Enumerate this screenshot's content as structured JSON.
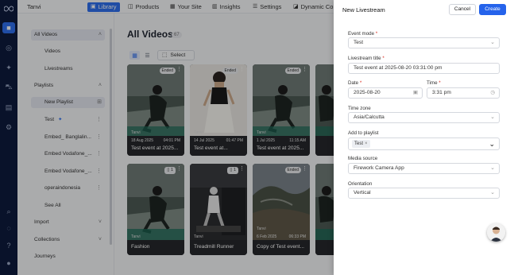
{
  "topbar": {
    "workspace": "Tanvi",
    "tabs": [
      {
        "label": "Library",
        "icon": "library-icon"
      },
      {
        "label": "Products",
        "icon": "bag-icon"
      },
      {
        "label": "Your Site",
        "icon": "globe-icon"
      },
      {
        "label": "Insights",
        "icon": "chart-icon"
      },
      {
        "label": "Settings",
        "icon": "settings-icon"
      },
      {
        "label": "Dynamic Co",
        "icon": "dynamic-icon"
      }
    ]
  },
  "sidebar": {
    "all_videos": "All Videos",
    "videos": "Videos",
    "livestreams": "Livestreams",
    "playlists": "Playlists",
    "new_playlist": "New Playlist",
    "playlist_items": [
      "Test",
      "Embed_ Banglalin...",
      "Embed Vodafone_...",
      "Embed Vodafone_...",
      "operaindonesia"
    ],
    "see_all": "See All",
    "import": "Import",
    "collections": "Collections",
    "journeys": "Journeys"
  },
  "main": {
    "title": "All Videos",
    "count": "67",
    "select_label": "Select",
    "cards": [
      {
        "title": "Test event at 2025...",
        "author": "Tanvi",
        "date": "18 Aug 2025",
        "time": "04:01 PM",
        "badge": "Ended"
      },
      {
        "title": "Test event at...",
        "author": "Tanvi",
        "date": "14 Jul 2025",
        "time": "01:47 PM",
        "badge": "Ended"
      },
      {
        "title": "Test event at 2025...",
        "author": "Tanvi",
        "date": "1 Jul 2025",
        "time": "11:15 AM",
        "badge": "Ended"
      },
      {
        "title": "",
        "author": "",
        "date": "",
        "time": "",
        "badge": ""
      },
      {
        "title": "Fashion",
        "author": "Tanvi",
        "date": "",
        "time": "",
        "badge": "1"
      },
      {
        "title": "Treadmill Runner",
        "author": "Tanvi",
        "date": "",
        "time": "",
        "badge": "1"
      },
      {
        "title": "Copy of Test event...",
        "author": "Tanvi",
        "date": "6 Feb 2025",
        "time": "06:33 PM",
        "badge": "Ended"
      },
      {
        "title": "",
        "author": "",
        "date": "",
        "time": "",
        "badge": ""
      }
    ]
  },
  "drawer": {
    "title": "New Livestream",
    "cancel": "Cancel",
    "create": "Create",
    "event_mode": {
      "label": "Event mode",
      "value": "Test"
    },
    "livestream_title": {
      "label": "Livestream title",
      "value": "Test event at 2025-08-20 03:31:00 pm"
    },
    "date": {
      "label": "Date",
      "value": "2025-08-20"
    },
    "time": {
      "label": "Time",
      "value": "3:31 pm"
    },
    "time_zone": {
      "label": "Time zone",
      "value": "Asia/Calcutta"
    },
    "add_to_playlist": {
      "label": "Add to playlist",
      "chip": "Test"
    },
    "media_source": {
      "label": "Media source",
      "value": "Firework Camera App"
    },
    "orientation": {
      "label": "Orientation",
      "value": "Vertical"
    }
  },
  "colors": {
    "rail": "#0d1b3d",
    "accent": "#2f6fed",
    "create": "#2563eb",
    "required": "#d92d20"
  }
}
